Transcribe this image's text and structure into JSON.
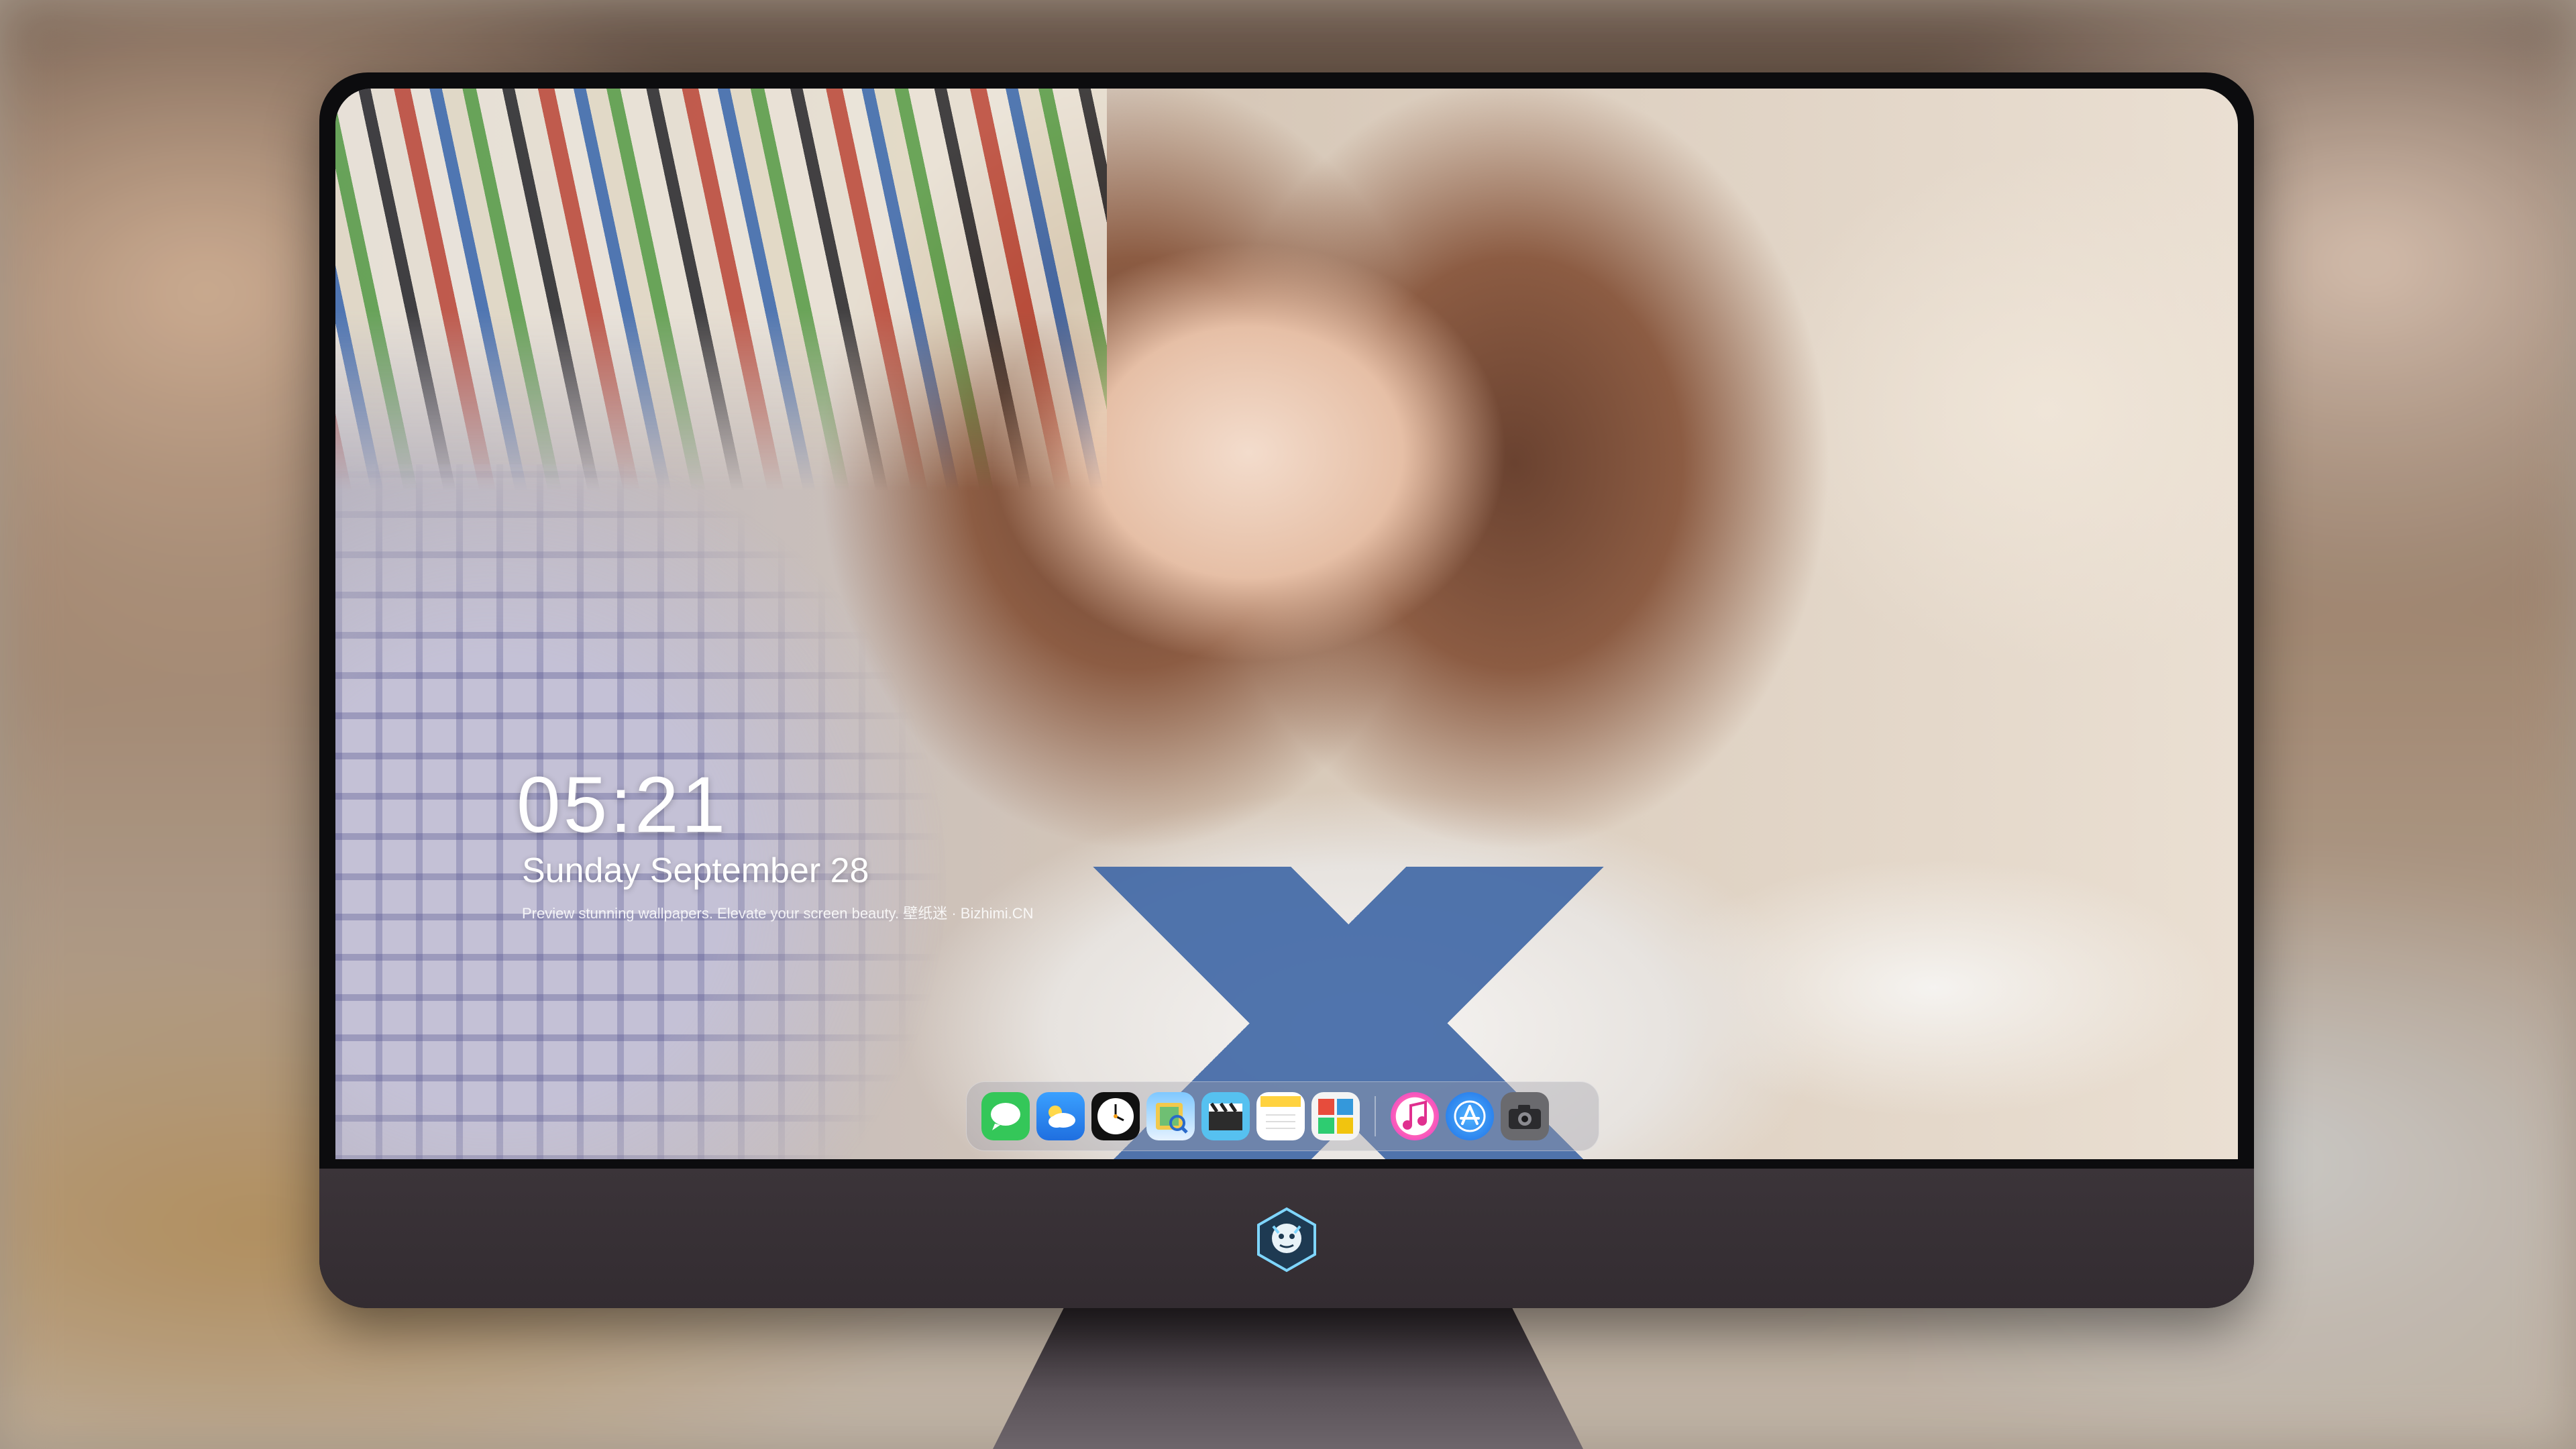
{
  "lockscreen": {
    "time": "05:21",
    "date": "Sunday September 28",
    "tagline": "Preview stunning wallpapers. Elevate your screen beauty. 壁纸迷 · Bizhimi.CN"
  },
  "dock": {
    "apps": [
      {
        "name": "messages-icon"
      },
      {
        "name": "weather-icon"
      },
      {
        "name": "clock-icon"
      },
      {
        "name": "preview-icon"
      },
      {
        "name": "clapper-icon"
      },
      {
        "name": "notes-icon"
      },
      {
        "name": "photo-booth-icon"
      },
      {
        "name": "music-icon"
      },
      {
        "name": "app-store-icon"
      },
      {
        "name": "camera-icon"
      }
    ]
  },
  "colors": {
    "messages": "#34c759",
    "weather": "#2f8ff0",
    "music": "#ff3fa5",
    "app_store": "#1e8bff",
    "chin": "#38313a"
  }
}
